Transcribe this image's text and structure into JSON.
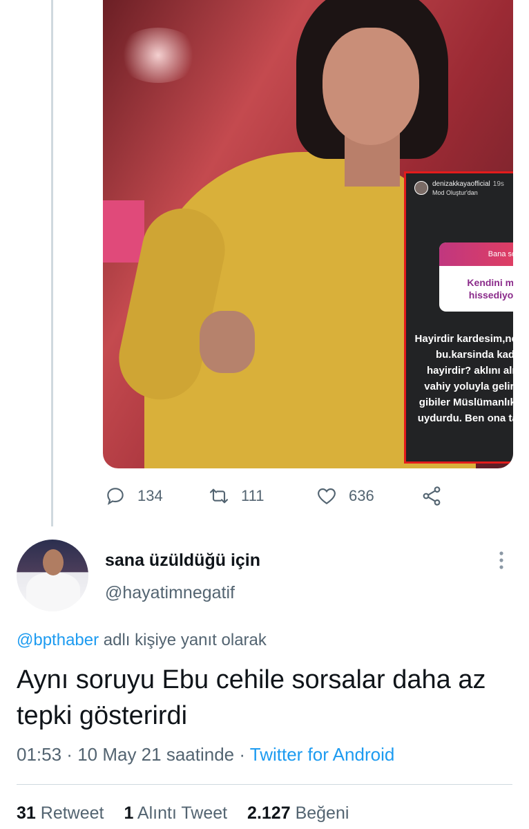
{
  "media": {
    "story": {
      "username": "denizakkayaofficial",
      "time": "19s",
      "subtitle": "Mod Oluştur'dan",
      "question_header": "Bana soru sor",
      "question": "Kendini müslümam hissediyormusun?",
      "answer": "Hayirdir kardesim,ne dangalakca soru  bu.karsinda kadin var diye mi hayirdir? aklını alırım  cevap sana vahiy yoluyla gelir! ZEVZEK Senin gibiler  Müslümanlık diye yeni bir din uydurdu. Ben ona tabi ve ait degilim!"
    }
  },
  "quoted_actions": {
    "replies": "134",
    "retweets": "111",
    "likes": "636"
  },
  "author": {
    "display_name": "sana üzüldüğü için",
    "handle": "@hayatimnegatif"
  },
  "reply_to": {
    "mention": "@bpthaber",
    "suffix": " adlı kişiye yanıt olarak"
  },
  "tweet": {
    "text": "Aynı soruyu Ebu cehile sorsalar daha az tepki gösterirdi",
    "time": "01:53",
    "date": "10 May 21 saatinde",
    "separator": " · ",
    "source": "Twitter for Android"
  },
  "stats": {
    "retweets_count": "31",
    "retweets_label": "Retweet",
    "quotes_count": "1",
    "quotes_label": "Alıntı Tweet",
    "likes_count": "2.127",
    "likes_label": "Beğeni"
  },
  "colors": {
    "accent": "#1d9bf0",
    "muted": "#536471",
    "story_border": "#e31c1c"
  }
}
